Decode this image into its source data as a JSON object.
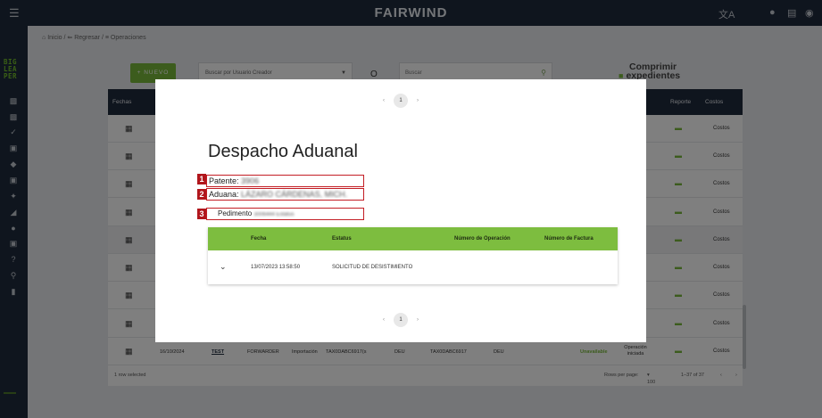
{
  "topbar": {
    "brand": "FAIRWIND",
    "menu_icon": "hamburger-icon",
    "icons": [
      "translate-icon",
      "bell-icon",
      "chat-icon",
      "account-icon"
    ]
  },
  "sidebar": {
    "logo_lines": [
      "BIG",
      "LEA",
      "PER"
    ],
    "icons": [
      "clipboard-icon",
      "badge-icon",
      "check-icon",
      "box-icon",
      "tag-icon",
      "id-card-icon",
      "run-icon",
      "chart-icon",
      "truck-icon",
      "card-icon",
      "help-icon",
      "search-icon",
      "door-icon"
    ]
  },
  "breadcrumb": {
    "home": "Inicio",
    "back": "Regresar",
    "current": "Operaciones"
  },
  "toolbar": {
    "new_button": "NUEVO",
    "user_select_placeholder": "Buscar por Usuario Creador",
    "or_label": "O",
    "search_placeholder": "Buscar",
    "compress_label_1": "Comprimir",
    "compress_label_2": "expedientes"
  },
  "table": {
    "headers": {
      "fechas": "Fechas",
      "reporte": "Reporte",
      "costos": "Costos"
    },
    "rows": [
      {
        "costos": "Costos"
      },
      {
        "costos": "Costos"
      },
      {
        "costos": "Costos"
      },
      {
        "costos": "Costos"
      },
      {
        "costos": "Costos"
      },
      {
        "costos": "Costos"
      },
      {
        "costos": "Costos"
      },
      {
        "costos": "Costos"
      },
      {
        "fecha": "16/10/2024",
        "link": "TEST",
        "tipo": "FORWARDER",
        "modo": "Importación",
        "ref": "TAX0DABC6917(s",
        "pais1": "DEU",
        "ref2": "TAX0DABC6917",
        "pais2": "DEU",
        "status": "Unavailable",
        "estado_1": "Operación",
        "estado_2": "iniciada",
        "costos": "Costos"
      }
    ],
    "footer": {
      "selected": "1 row selected",
      "rows_per_page_label": "Rows per page:",
      "rows_per_page_value": "100",
      "range": "1–37 of 37"
    }
  },
  "modal": {
    "page_number": "1",
    "title": "Despacho Aduanal",
    "markers": [
      "1",
      "2",
      "3"
    ],
    "patente_label": "Patente:",
    "patente_value": "3906",
    "aduana_label": "Aduana:",
    "aduana_value": "LÁZARO CÁRDENAS, MICH.",
    "pedimento_label": "Pedimento",
    "pedimento_value": "3006444 Estatus",
    "detail": {
      "headers": {
        "fecha": "Fecha",
        "estatus": "Estatus",
        "num_operacion": "Número de Operación",
        "num_factura": "Número de Factura"
      },
      "row": {
        "fecha": "13/07/2023 13:58:50",
        "estatus": "SOLICITUD DE DESISTIMIENTO"
      }
    }
  }
}
